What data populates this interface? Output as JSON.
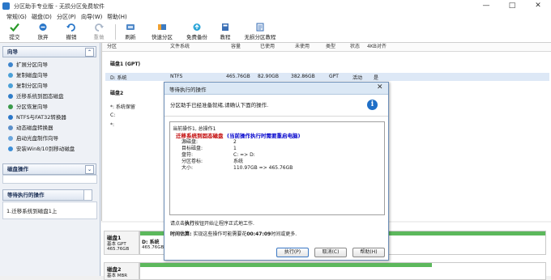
{
  "window": {
    "title": "分区助手专业版 - 无损分区免费软件"
  },
  "menu": [
    "常规(G)",
    "磁盘(D)",
    "分区(P)",
    "向导(W)",
    "帮助(H)"
  ],
  "toolbar": {
    "commit": "提交",
    "discard": "放弃",
    "undo": "撤销",
    "redo": "重做",
    "refresh": "刷新",
    "quick_partition": "快速分区",
    "free_backup": "免费备份",
    "tutorial": "教程",
    "lossless": "无损分区教程"
  },
  "sidebar": {
    "wizard_title": "向导",
    "wizard_items": [
      "扩展分区向导",
      "复制磁盘向导",
      "复制分区向导",
      "迁移系统到固态磁盘",
      "分区恢复向导",
      "NTFS与FAT32转换器",
      "动态磁盘转换器",
      "启动光盘制作向导",
      "安装Win8/10到移动磁盘"
    ],
    "disk_ops_title": "磁盘操作",
    "pending_title": "等待执行的操作",
    "pending_items": [
      "1.迁移系统到磁盘1上"
    ]
  },
  "table": {
    "headers": [
      "分区",
      "文件系统",
      "容量",
      "已使用",
      "未使用",
      "类型",
      "状态",
      "4KB对齐"
    ],
    "disk1_label": "磁盘1 (GPT)",
    "disk1_row": [
      "D: 系统",
      "NTFS",
      "465.76GB",
      "82.90GB",
      "382.86GB",
      "GPT",
      "活动",
      "是"
    ],
    "disk2_label": "磁盘2",
    "disk2_rows": [
      "*: 系统保留",
      "C:",
      "*:"
    ]
  },
  "diskmap": {
    "disk1_name": "磁盘1",
    "disk1_type": "基本 GPT",
    "disk1_size": "465.76GB",
    "disk1_part_name": "D: 系统",
    "disk1_part_detail": "465.76GB NTFS",
    "disk2_name": "磁盘2",
    "disk2_type": "基本 MBR",
    "disk2_used_fraction": 0.72
  },
  "dialog": {
    "title": "等待执行的操作",
    "message": "分区助手已经准备就绪,请确认下面的操作.",
    "op_header": "当前操作1, 总操作1",
    "op_title": "迁移系统到固态磁盘",
    "op_note": "(当前操作执行时需要重启电脑)",
    "fields": [
      {
        "k": "源磁盘:",
        "v": "2"
      },
      {
        "k": "目标磁盘:",
        "v": "1"
      },
      {
        "k": "盘符:",
        "v": "C: => D:"
      },
      {
        "k": "分区卷标:",
        "v": "系统"
      },
      {
        "k": "大小:",
        "v": "110.97GB => 465.76GB"
      }
    ],
    "hint_prefix": "请点击",
    "hint_bold": "执行",
    "hint_suffix": "按钮开始让程序正式地工作.",
    "time_label": "时间估算:",
    "time_text_a": "实现这些操作可能需要花",
    "time_value": "00:47:09",
    "time_text_b": "时间或更多.",
    "buttons": {
      "execute": "执行(P)",
      "cancel": "取消(C)",
      "help": "帮助(H)"
    }
  },
  "colors": {
    "accent": "#2a77c9",
    "diskbar": "#5cb85c",
    "op_red": "#c00000",
    "op_blue": "#0000cc"
  }
}
